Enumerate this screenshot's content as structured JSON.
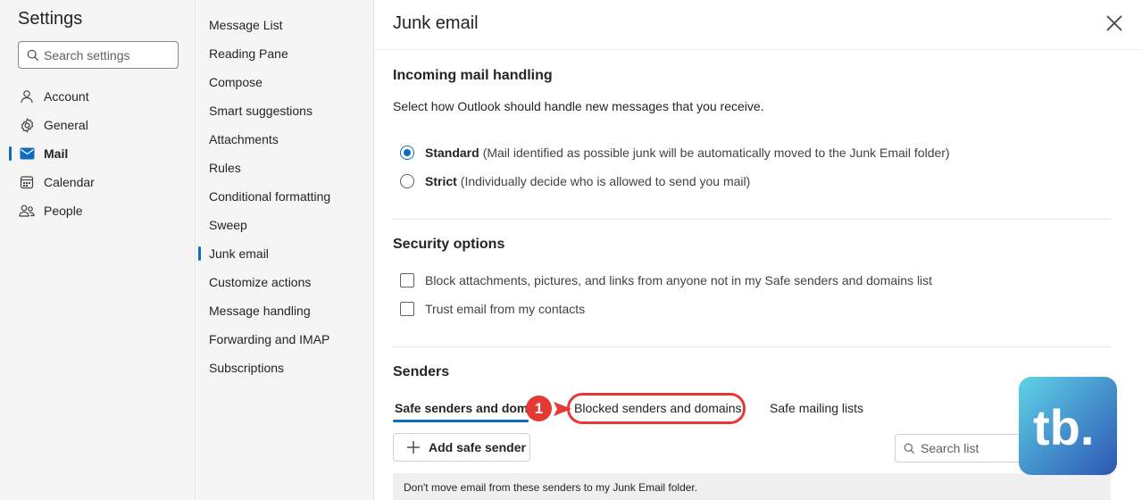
{
  "sidebar": {
    "title": "Settings",
    "search_placeholder": "Search settings",
    "items": [
      {
        "label": "Account",
        "icon": "person-icon"
      },
      {
        "label": "General",
        "icon": "gear-icon"
      },
      {
        "label": "Mail",
        "icon": "mail-icon",
        "active": true
      },
      {
        "label": "Calendar",
        "icon": "calendar-icon"
      },
      {
        "label": "People",
        "icon": "people-icon"
      }
    ]
  },
  "submenu": {
    "items": [
      "Message List",
      "Reading Pane",
      "Compose",
      "Smart suggestions",
      "Attachments",
      "Rules",
      "Conditional formatting",
      "Sweep",
      "Junk email",
      "Customize actions",
      "Message handling",
      "Forwarding and IMAP",
      "Subscriptions"
    ],
    "active": "Junk email"
  },
  "main": {
    "title": "Junk email",
    "incoming": {
      "title": "Incoming mail handling",
      "description": "Select how Outlook should handle new messages that you receive.",
      "options": [
        {
          "label": "Standard",
          "desc": "(Mail identified as possible junk will be automatically moved to the Junk Email folder)",
          "selected": true
        },
        {
          "label": "Strict",
          "desc": "(Individually decide who is allowed to send you mail)",
          "selected": false
        }
      ]
    },
    "security": {
      "title": "Security options",
      "options": [
        {
          "label": "Block attachments, pictures, and links from anyone not in my Safe senders and domains list",
          "checked": false
        },
        {
          "label": "Trust email from my contacts",
          "checked": false
        }
      ]
    },
    "senders": {
      "title": "Senders",
      "tabs": [
        {
          "label": "Safe senders and domains",
          "active": true
        },
        {
          "label": "Blocked senders and domains"
        },
        {
          "label": "Safe mailing lists"
        }
      ],
      "add_button": "Add safe sender",
      "search_placeholder": "Search list",
      "info": "Don't move email from these senders to my Junk Email folder."
    }
  },
  "annotation": {
    "badge": "1",
    "color": "#e53935"
  },
  "logo": {
    "text": "tb.",
    "gradient": [
      "#5fd3e6",
      "#2d55b4"
    ]
  },
  "colors": {
    "accent": "#0f6cbd",
    "sidebar_bg": "#f5f5f5"
  }
}
